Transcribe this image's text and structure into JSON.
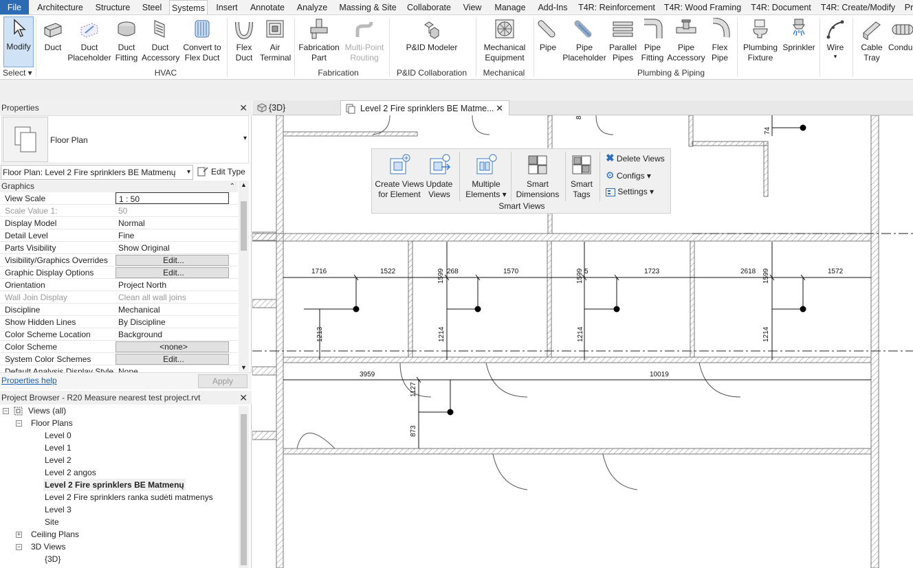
{
  "tabs": [
    "File",
    "Architecture",
    "Structure",
    "Steel",
    "Systems",
    "Insert",
    "Annotate",
    "Analyze",
    "Massing & Site",
    "Collaborate",
    "View",
    "Manage",
    "Add-Ins",
    "T4R: Reinforcement",
    "T4R: Wood Framing",
    "T4R: Document",
    "T4R: Create/Modify",
    "Pr"
  ],
  "ribbon": {
    "tools": [
      {
        "l1": "Modify",
        "l2": "",
        "icon": "cursor-icon"
      },
      {
        "l1": "Duct",
        "l2": "",
        "icon": "duct-icon"
      },
      {
        "l1": "Duct",
        "l2": "Placeholder",
        "icon": "duct-placeholder-icon"
      },
      {
        "l1": "Duct",
        "l2": "Fitting",
        "icon": "duct-fitting-icon"
      },
      {
        "l1": "Duct",
        "l2": "Accessory",
        "icon": "duct-accessory-icon"
      },
      {
        "l1": "Convert to",
        "l2": "Flex Duct",
        "icon": "convert-flex-duct-icon"
      },
      {
        "l1": "Flex",
        "l2": "Duct",
        "icon": "flex-duct-icon"
      },
      {
        "l1": "Air",
        "l2": "Terminal",
        "icon": "air-terminal-icon"
      },
      {
        "l1": "Fabrication",
        "l2": "Part",
        "icon": "fabrication-part-icon"
      },
      {
        "l1": "Multi-Point",
        "l2": "Routing",
        "icon": "multi-point-routing-icon"
      },
      {
        "l1": "P&ID Modeler",
        "l2": "",
        "icon": "pid-modeler-icon"
      },
      {
        "l1": "Mechanical",
        "l2": "Equipment",
        "icon": "mechanical-equipment-icon"
      },
      {
        "l1": "Pipe",
        "l2": "",
        "icon": "pipe-icon"
      },
      {
        "l1": "Pipe",
        "l2": "Placeholder",
        "icon": "pipe-placeholder-icon"
      },
      {
        "l1": "Parallel",
        "l2": "Pipes",
        "icon": "parallel-pipes-icon"
      },
      {
        "l1": "Pipe",
        "l2": "Fitting",
        "icon": "pipe-fitting-icon"
      },
      {
        "l1": "Pipe",
        "l2": "Accessory",
        "icon": "pipe-accessory-icon"
      },
      {
        "l1": "Flex",
        "l2": "Pipe",
        "icon": "flex-pipe-icon"
      },
      {
        "l1": "Plumbing",
        "l2": "Fixture",
        "icon": "plumbing-fixture-icon"
      },
      {
        "l1": "Sprinkler",
        "l2": "",
        "icon": "sprinkler-icon"
      },
      {
        "l1": "Wire",
        "l2": "",
        "icon": "wire-icon"
      },
      {
        "l1": "Cable",
        "l2": "Tray",
        "icon": "cable-tray-icon"
      },
      {
        "l1": "Condui",
        "l2": "",
        "icon": "conduit-icon"
      }
    ],
    "groups": [
      "Select ▾",
      "HVAC",
      "Fabrication",
      "P&ID Collaboration",
      "Mechanical",
      "Plumbing & Piping"
    ]
  },
  "properties": {
    "title": "Properties",
    "type_name": "Floor Plan",
    "selector": "Floor Plan: Level 2 Fire sprinklers BE Matmenų",
    "edit_type": "Edit Type",
    "section": "Graphics",
    "rows": [
      {
        "k": "View Scale",
        "v": "1 : 50"
      },
      {
        "k": "Scale Value    1:",
        "v": "50"
      },
      {
        "k": "Display Model",
        "v": "Normal"
      },
      {
        "k": "Detail Level",
        "v": "Fine"
      },
      {
        "k": "Parts Visibility",
        "v": "Show Original"
      },
      {
        "k": "Visibility/Graphics Overrides",
        "v": "Edit..."
      },
      {
        "k": "Graphic Display Options",
        "v": "Edit..."
      },
      {
        "k": "Orientation",
        "v": "Project North"
      },
      {
        "k": "Wall Join Display",
        "v": "Clean all wall joins"
      },
      {
        "k": "Discipline",
        "v": "Mechanical"
      },
      {
        "k": "Show Hidden Lines",
        "v": "By Discipline"
      },
      {
        "k": "Color Scheme Location",
        "v": "Background"
      },
      {
        "k": "Color Scheme",
        "v": "<none>"
      },
      {
        "k": "System Color Schemes",
        "v": "Edit..."
      },
      {
        "k": "Default Analysis Display Style",
        "v": "None"
      }
    ],
    "help": "Properties help",
    "apply": "Apply"
  },
  "browser": {
    "title": "Project Browser - R20 Measure nearest test project.rvt",
    "items": [
      "Views (all)",
      "Floor Plans",
      "Level 0",
      "Level 1",
      "Level 2",
      "Level 2 angos",
      "Level 2 Fire sprinklers BE Matmenų",
      "Level 2 Fire sprinklers ranka sudėti matmenys",
      "Level 3",
      "Site",
      "Ceiling Plans",
      "3D Views",
      "{3D}"
    ]
  },
  "view_tabs": [
    {
      "label": "{3D}"
    },
    {
      "label": "Level 2 Fire sprinklers BE Matme..."
    }
  ],
  "smart_views": {
    "buttons": [
      {
        "l1": "Create Views",
        "l2": "for Element"
      },
      {
        "l1": "Update",
        "l2": "Views"
      },
      {
        "l1": "Multiple",
        "l2": "Elements ▾"
      },
      {
        "l1": "Smart",
        "l2": "Dimensions"
      },
      {
        "l1": "Smart",
        "l2": "Tags"
      }
    ],
    "side": [
      "Delete Views",
      "Configs ▾",
      "Settings ▾"
    ],
    "group": "Smart Views"
  },
  "dims": [
    "74",
    "8",
    "1716",
    "1522",
    "268",
    "1570",
    "1599",
    "1599",
    "5",
    "1723",
    "2618",
    "1599",
    "1572",
    "1213",
    "1214",
    "1214",
    "1214",
    "3959",
    "10019",
    "1127",
    "873"
  ],
  "colors": {
    "accent": "#2b6bb3",
    "select": "#cfe2f6",
    "link": "#1a5fb4"
  }
}
